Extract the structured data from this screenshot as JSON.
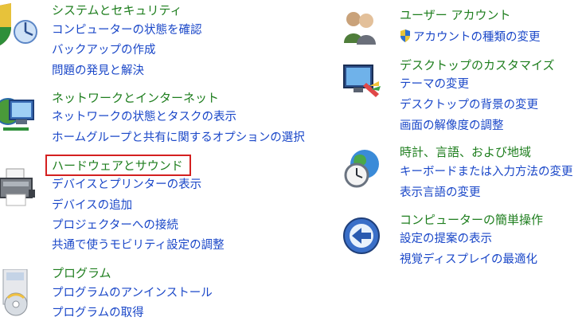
{
  "left": {
    "system_security": {
      "title": "システムとセキュリティ",
      "links": [
        "コンピューターの状態を確認",
        "バックアップの作成",
        "問題の発見と解決"
      ]
    },
    "network": {
      "title": "ネットワークとインターネット",
      "links": [
        "ネットワークの状態とタスクの表示",
        "ホームグループと共有に関するオプションの選択"
      ]
    },
    "hardware": {
      "title": "ハードウェアとサウンド",
      "links": [
        "デバイスとプリンターの表示",
        "デバイスの追加",
        "プロジェクターへの接続",
        "共通で使うモビリティ設定の調整"
      ]
    },
    "programs": {
      "title": "プログラム",
      "links": [
        "プログラムのアンインストール",
        "プログラムの取得"
      ]
    }
  },
  "right": {
    "user_accounts": {
      "title": "ユーザー アカウント",
      "links": [
        "アカウントの種類の変更"
      ]
    },
    "appearance": {
      "title": "デスクトップのカスタマイズ",
      "links": [
        "テーマの変更",
        "デスクトップの背景の変更",
        "画面の解像度の調整"
      ]
    },
    "clock_region": {
      "title": "時計、言語、および地域",
      "links": [
        "キーボードまたは入力方法の変更",
        "表示言語の変更"
      ]
    },
    "ease_of_access": {
      "title": "コンピューターの簡単操作",
      "links": [
        "設定の提案の表示",
        "視覚ディスプレイの最適化"
      ]
    }
  },
  "colors": {
    "category_title": "#1e7e1e",
    "link": "#1a47c8",
    "highlight_border": "#d42020"
  }
}
